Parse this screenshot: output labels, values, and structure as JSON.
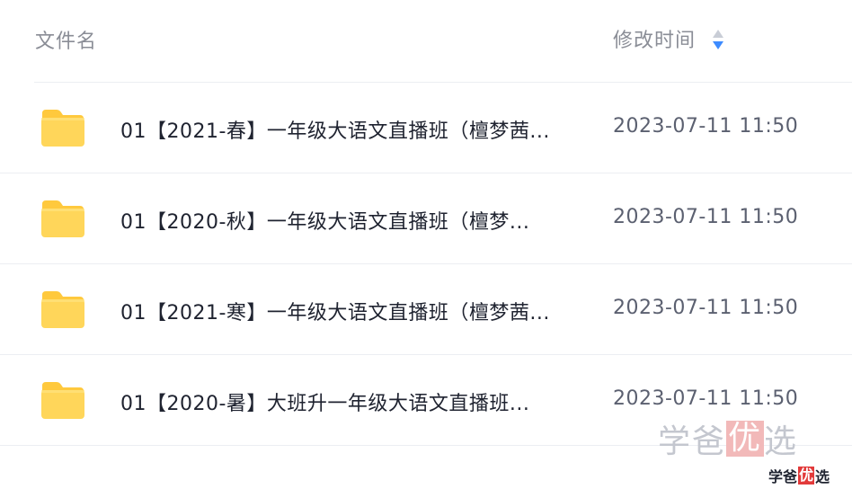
{
  "header": {
    "name_label": "文件名",
    "time_label": "修改时间"
  },
  "colors": {
    "folder": "#ffd34d",
    "sort_active": "#3d8bff",
    "sort_inactive": "#c9cdd6"
  },
  "files": [
    {
      "name": "01【2021-春】一年级大语文直播班（檀梦茜...",
      "time": "2023-07-11 11:50",
      "icon": "folder-icon"
    },
    {
      "name": "01【2020-秋】一年级大语文直播班（檀梦...",
      "time": "2023-07-11 11:50",
      "icon": "folder-icon"
    },
    {
      "name": "01【2021-寒】一年级大语文直播班（檀梦茜...",
      "time": "2023-07-11 11:50",
      "icon": "folder-icon"
    },
    {
      "name": "01【2020-暑】大班升一年级大语文直播班...",
      "time": "2023-07-11 11:50",
      "icon": "folder-icon"
    }
  ],
  "watermark": {
    "large_a": "学爸",
    "large_b": "优",
    "large_c": "选",
    "small_a": "学爸",
    "small_b": "优",
    "small_c": "选"
  }
}
